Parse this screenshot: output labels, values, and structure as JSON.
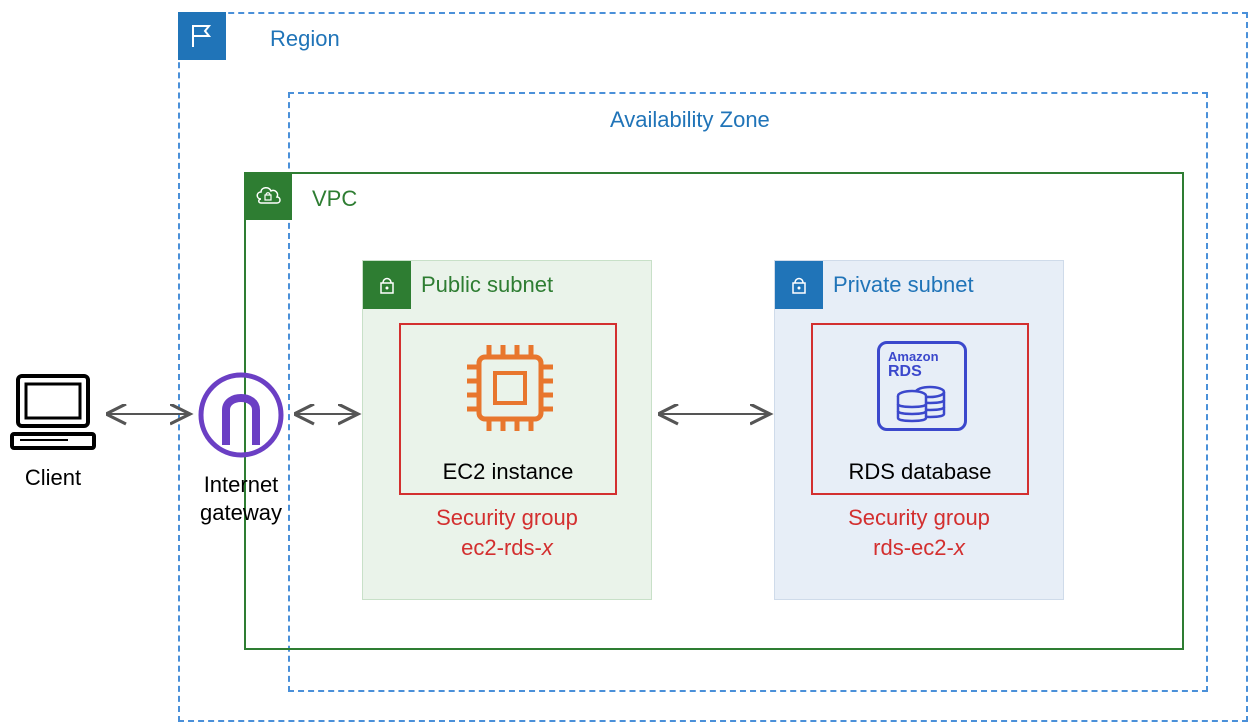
{
  "region": {
    "label": "Region"
  },
  "az": {
    "label": "Availability Zone"
  },
  "vpc": {
    "label": "VPC"
  },
  "public_subnet": {
    "label": "Public subnet",
    "instance_label": "EC2 instance",
    "sg_line1": "Security group",
    "sg_line2_prefix": "ec2-rds-",
    "sg_line2_suffix": "x"
  },
  "private_subnet": {
    "label": "Private subnet",
    "instance_label": "RDS database",
    "rds_brand_line1": "Amazon",
    "rds_brand_line2": "RDS",
    "sg_line1": "Security group",
    "sg_line2_prefix": "rds-ec2-",
    "sg_line2_suffix": "x"
  },
  "client": {
    "label": "Client"
  },
  "igw": {
    "line1": "Internet",
    "line2": "gateway"
  },
  "colors": {
    "region_blue": "#2074b8",
    "vpc_green": "#2e7d32",
    "security_red": "#d32f2f",
    "ec2_orange": "#e8762d",
    "rds_purple": "#3b48cc",
    "igw_purple": "#6b3fc4"
  }
}
